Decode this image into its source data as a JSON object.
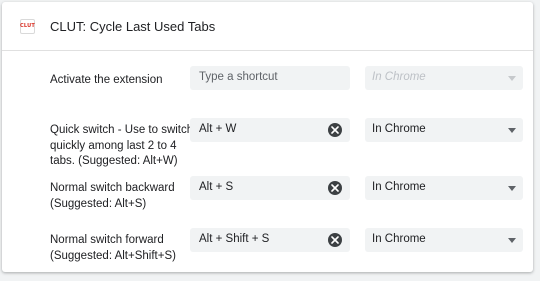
{
  "extension": {
    "icon_text": "CLUT",
    "title": "CLUT: Cycle Last Used Tabs"
  },
  "shortcuts": [
    {
      "label": "Activate the extension",
      "value": "",
      "placeholder": "Type a shortcut",
      "scope": "In Chrome",
      "scope_enabled": false,
      "clearable": false
    },
    {
      "label": "Quick switch - Use to switch quickly among last 2 to 4 tabs. (Suggested: Alt+W)",
      "value": "Alt + W",
      "placeholder": "Type a shortcut",
      "scope": "In Chrome",
      "scope_enabled": true,
      "clearable": true
    },
    {
      "label": "Normal switch backward (Suggested: Alt+S)",
      "value": "Alt + S",
      "placeholder": "Type a shortcut",
      "scope": "In Chrome",
      "scope_enabled": true,
      "clearable": true
    },
    {
      "label": "Normal switch forward (Suggested: Alt+Shift+S)",
      "value": "Alt + Shift + S",
      "placeholder": "Type a shortcut",
      "scope": "In Chrome",
      "scope_enabled": true,
      "clearable": true
    }
  ],
  "colors": {
    "card_background": "#ffffff",
    "page_background": "#f1f3f4",
    "field_background": "#f1f3f4",
    "icon_accent": "#d93025"
  }
}
